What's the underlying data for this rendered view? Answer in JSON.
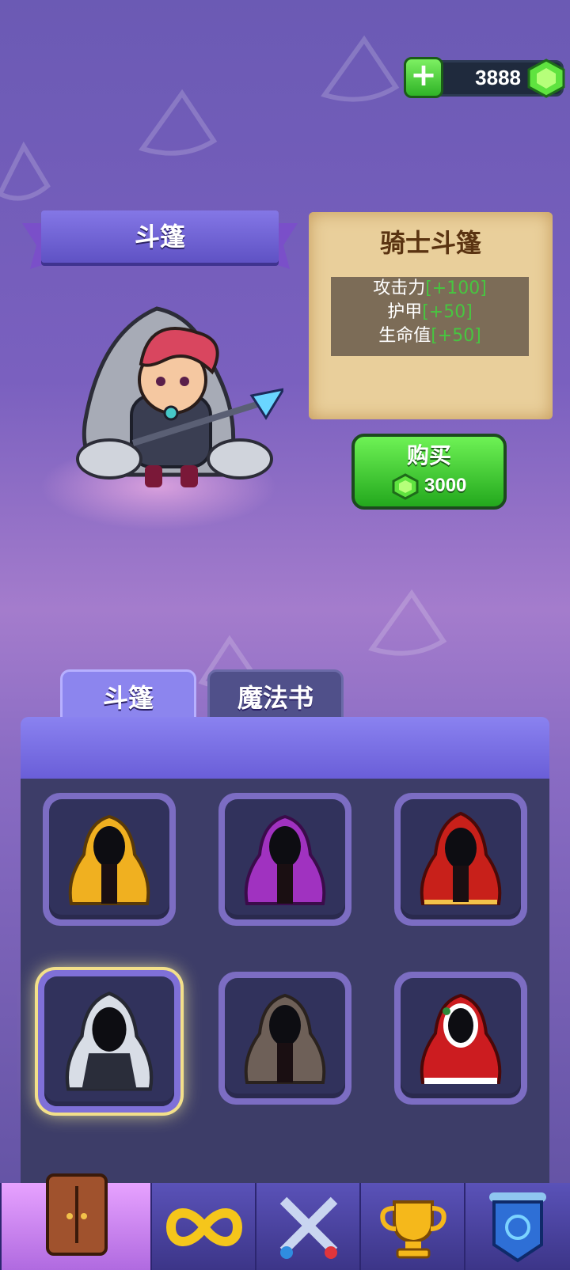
{
  "currency": {
    "amount": "3888",
    "add_label": "+"
  },
  "section_ribbon": {
    "title": "斗篷"
  },
  "item_detail": {
    "name": "骑士斗篷",
    "stats": [
      {
        "label": "攻击力",
        "bonus": "[+100]"
      },
      {
        "label": "护甲",
        "bonus": "[+50]"
      },
      {
        "label": "生命值",
        "bonus": "[+50]"
      }
    ]
  },
  "buy_button": {
    "label": "购买",
    "price": "3000"
  },
  "tabs": [
    {
      "label": "斗篷",
      "active": true
    },
    {
      "label": "魔法书",
      "active": false
    }
  ],
  "cloaks": [
    {
      "icon": "yellow-cloak-icon",
      "color": "#f0b020"
    },
    {
      "icon": "purple-cloak-icon",
      "color": "#a032c0"
    },
    {
      "icon": "red-gold-cloak-icon",
      "color": "#c8201a"
    },
    {
      "icon": "knight-cloak-icon",
      "color": "#d8dde6",
      "selected": true
    },
    {
      "icon": "brown-stone-cloak-icon",
      "color": "#6e6058"
    },
    {
      "icon": "christmas-cloak-icon",
      "color": "#cc1c20"
    }
  ],
  "bottom_nav": [
    {
      "icon": "wardrobe-icon",
      "active": true
    },
    {
      "icon": "infinity-icon",
      "active": false
    },
    {
      "icon": "crossed-swords-icon",
      "active": false
    },
    {
      "icon": "trophy-icon",
      "active": false
    },
    {
      "icon": "banner-shield-icon",
      "active": false
    }
  ],
  "colors": {
    "accent_green": "#3fd12f",
    "bonus_green": "#47c640",
    "panel": "#3d3d68"
  }
}
